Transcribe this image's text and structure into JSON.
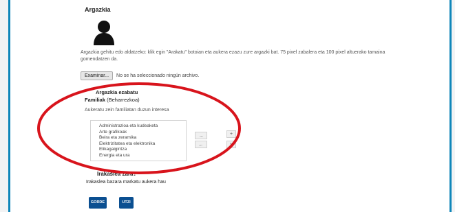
{
  "colors": {
    "frame_border": "#0f86b9",
    "button_blue": "#0b4f91",
    "annotation_red": "#d8141c"
  },
  "avatar": {
    "heading": "Argazkia",
    "icon": "user-silhouette-icon",
    "help_text_line1": "Argazkia gehitu edo aldatzeko: klik egin \"Arakatu\" botoian eta aukera ezazu zure argazki bat. 75 pixel zabalera eta 100 pixel altuerako tamaina",
    "help_text_line2": "gomendatzen da.",
    "file_button_label": "Examinar...",
    "file_status": "No se ha seleccionado ningún archivo.",
    "delete_label": "Argazkia ezabatu"
  },
  "families": {
    "title": "Familiak",
    "subtitle": "(Beharrezkoa)",
    "instructions": "Aukeratu zein familiatan duzun interesa",
    "options": [
      "Administrazioa eta kudeaketa",
      "Arte grafikoak",
      "Beira eta zeramika",
      "Elektrizitatea eta elektronika",
      "Elikagaigintza",
      "Energia eta ura"
    ],
    "move_right_label": "→",
    "move_left_label": "←",
    "up_label": "+",
    "down_label": "v"
  },
  "teacher": {
    "question": "Irakaslea zara?",
    "instruction": "Irakaslea bazara markatu aukera hau"
  },
  "actions": {
    "save_label": "GORDE",
    "cancel_label": "UTZI"
  }
}
